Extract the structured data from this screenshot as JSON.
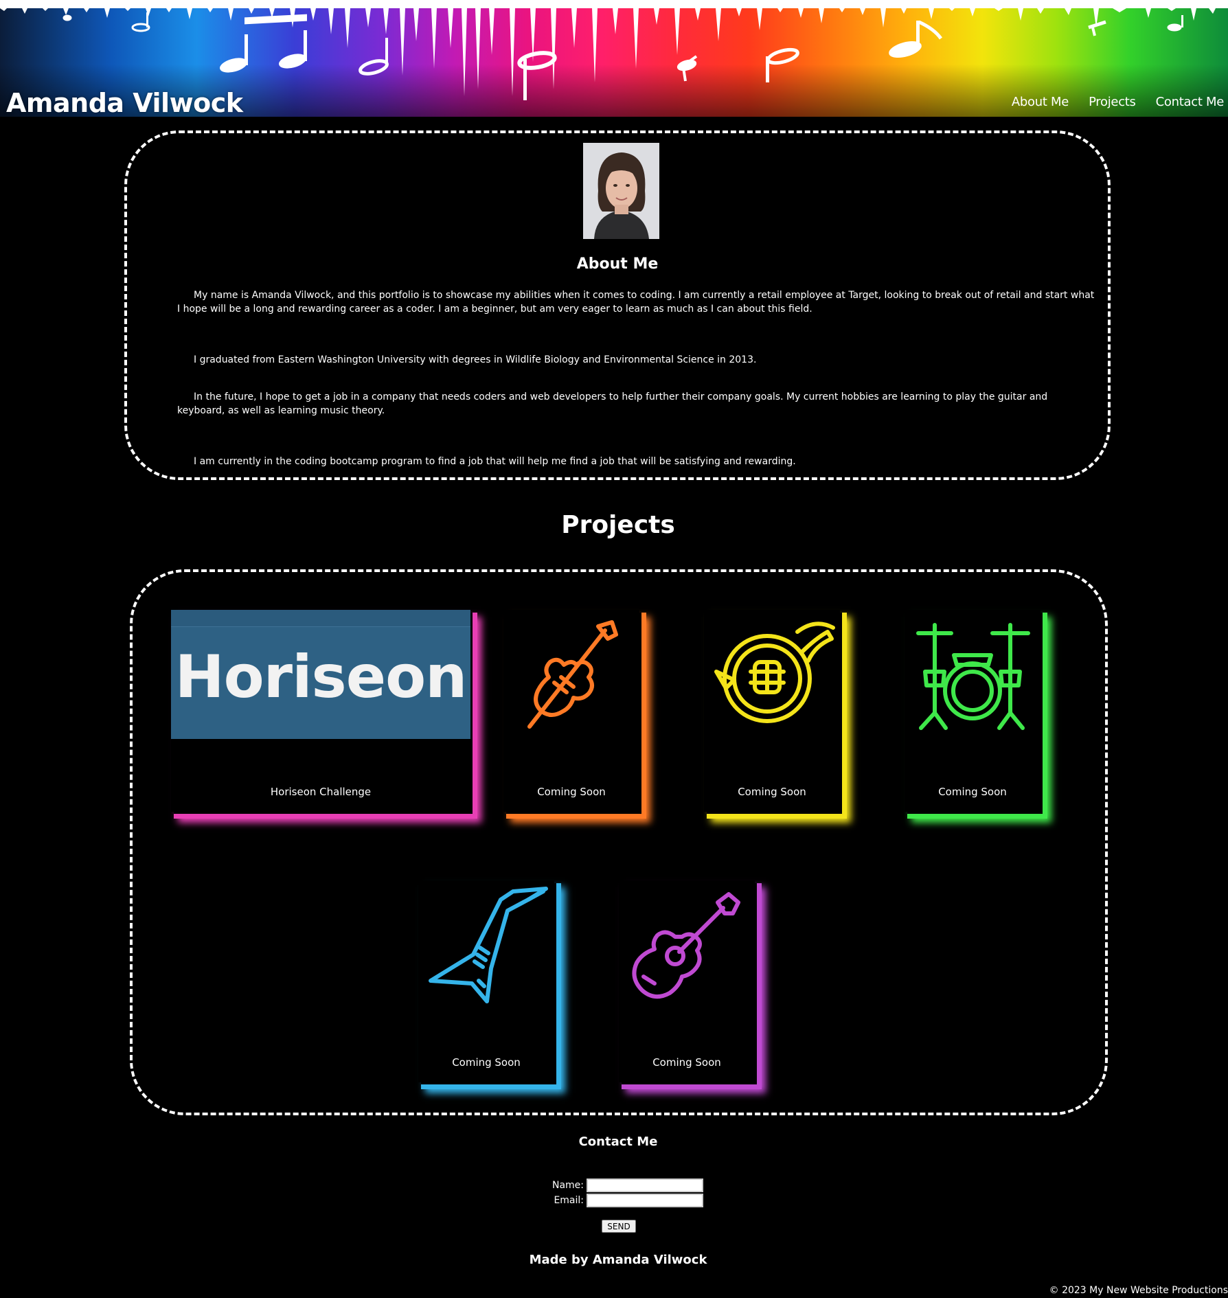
{
  "header": {
    "title": "Amanda Vilwock",
    "nav": [
      "About Me",
      "Projects",
      "Contact Me"
    ]
  },
  "about": {
    "heading": "About Me",
    "paragraphs": [
      "My name is Amanda Vilwock, and this portfolio is to showcase my abilities when it comes to coding. I am currently a retail employee at Target, looking to break out of retail and start what I hope will be a long and rewarding career as a coder. I am a beginner, but am very eager to learn as much as I can about this field.",
      "I graduated from Eastern Washington University with degrees in Wildlife Biology and Environmental Science in 2013.",
      "In the future, I hope to get a job in a company that needs coders and web developers to help further their company goals. My current hobbies are learning to play the guitar and keyboard, as well as learning music theory.",
      "I am currently in the coding bootcamp program to find a job that will help me find a job that will be satisfying and rewarding."
    ]
  },
  "projects": {
    "heading": "Projects",
    "items": [
      {
        "label": "Horiseon Challenge",
        "banner_text": "Horiseon",
        "banner_color": "#2e6184",
        "accent": "#e83fb5",
        "icon": "horiseon-banner"
      },
      {
        "label": "Coming Soon",
        "accent": "#ff7a25",
        "icon": "violin-icon"
      },
      {
        "label": "Coming Soon",
        "accent": "#f4e41a",
        "icon": "french-horn-icon"
      },
      {
        "label": "Coming Soon",
        "accent": "#3fe84a",
        "icon": "drum-kit-icon"
      },
      {
        "label": "Coming Soon",
        "accent": "#35b4ea",
        "icon": "electric-guitar-icon"
      },
      {
        "label": "Coming Soon",
        "accent": "#c04ad2",
        "icon": "acoustic-guitar-icon"
      }
    ]
  },
  "contact": {
    "heading": "Contact Me",
    "name_label": "Name:",
    "name_value": "",
    "email_label": "Email:",
    "email_value": "",
    "send_label": "SEND"
  },
  "footer": {
    "made_by": "Made by Amanda Vilwock",
    "copyright": "© 2023 My New Website Productions"
  }
}
